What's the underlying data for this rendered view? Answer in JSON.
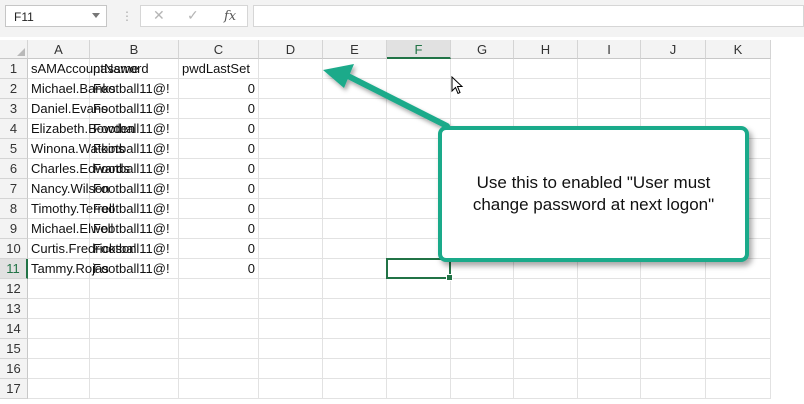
{
  "name_box": {
    "value": "F11"
  },
  "formula_bar": {
    "cancel_icon": "✕",
    "enter_icon": "✓",
    "fx_label": "fx",
    "value": ""
  },
  "columns": [
    "A",
    "B",
    "C",
    "D",
    "E",
    "F",
    "G",
    "H",
    "I",
    "J",
    "K"
  ],
  "rows": [
    "1",
    "2",
    "3",
    "4",
    "5",
    "6",
    "7",
    "8",
    "9",
    "10",
    "11",
    "12",
    "13",
    "14",
    "15",
    "16",
    "17"
  ],
  "active_cell": {
    "column": "F",
    "row": "11"
  },
  "table": {
    "headers": [
      "sAMAccountName",
      "password",
      "pwdLastSet"
    ],
    "records": [
      [
        "Michael.Banks",
        "Football11@!",
        "0"
      ],
      [
        "Daniel.Evans",
        "Football11@!",
        "0"
      ],
      [
        "Elizabeth.Bowden",
        "Football11@!",
        "0"
      ],
      [
        "Winona.Watkins",
        "Football11@!",
        "0"
      ],
      [
        "Charles.Edwards",
        "Football11@!",
        "0"
      ],
      [
        "Nancy.Wilson",
        "Football11@!",
        "0"
      ],
      [
        "Timothy.Terrell",
        "Football11@!",
        "0"
      ],
      [
        "Michael.Elwell",
        "Football11@!",
        "0"
      ],
      [
        "Curtis.Fredrickson",
        "Football11@!",
        "0"
      ],
      [
        "Tammy.Rojas",
        "Football11@!",
        "0"
      ]
    ]
  },
  "callout": {
    "text": "Use this to enabled \"User must change password at next logon\"",
    "color": "#1aaa8a"
  },
  "accent_color": "#217346"
}
